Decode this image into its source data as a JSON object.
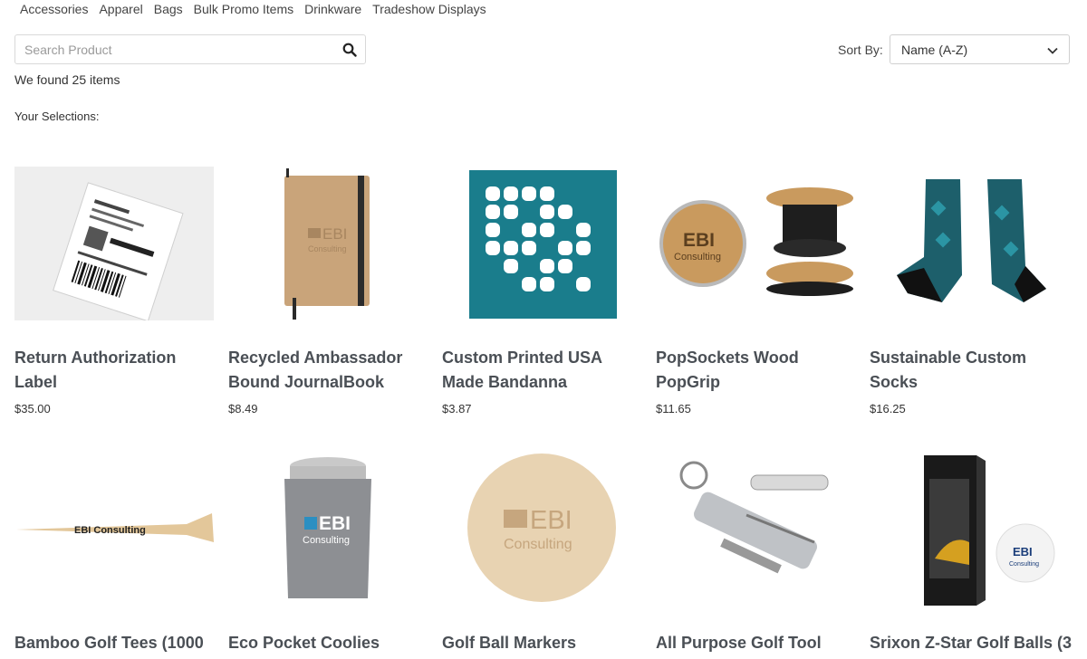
{
  "categories": [
    "Accessories",
    "Apparel",
    "Bags",
    "Bulk Promo Items",
    "Drinkware",
    "Tradeshow Displays"
  ],
  "search": {
    "placeholder": "Search Product"
  },
  "sort": {
    "label": "Sort By:",
    "value": "Name (A-Z)"
  },
  "results": {
    "found_text": "We found 25 items",
    "selections_label": "Your Selections:"
  },
  "products": [
    {
      "title": "Return Authorization Label",
      "price": "$35.00"
    },
    {
      "title": "Recycled Ambassador Bound JournalBook",
      "price": "$8.49"
    },
    {
      "title": "Custom Printed USA Made Bandanna",
      "price": "$3.87"
    },
    {
      "title": "PopSockets Wood PopGrip",
      "price": "$11.65"
    },
    {
      "title": "Sustainable Custom Socks",
      "price": "$16.25"
    },
    {
      "title": "Bamboo Golf Tees (1000",
      "price": ""
    },
    {
      "title": "Eco Pocket Coolies",
      "price": ""
    },
    {
      "title": "Golf Ball Markers",
      "price": ""
    },
    {
      "title": "All Purpose Golf Tool",
      "price": ""
    },
    {
      "title": "Srixon Z-Star Golf Balls (3",
      "price": ""
    }
  ],
  "brand": {
    "logo_word": "EBI",
    "logo_sub": "Consulting",
    "tee_text": "EBI Consulting",
    "accent": "#1a7d8c"
  },
  "icons": {
    "search": "search-icon",
    "sort": "chevron-down-icon"
  }
}
